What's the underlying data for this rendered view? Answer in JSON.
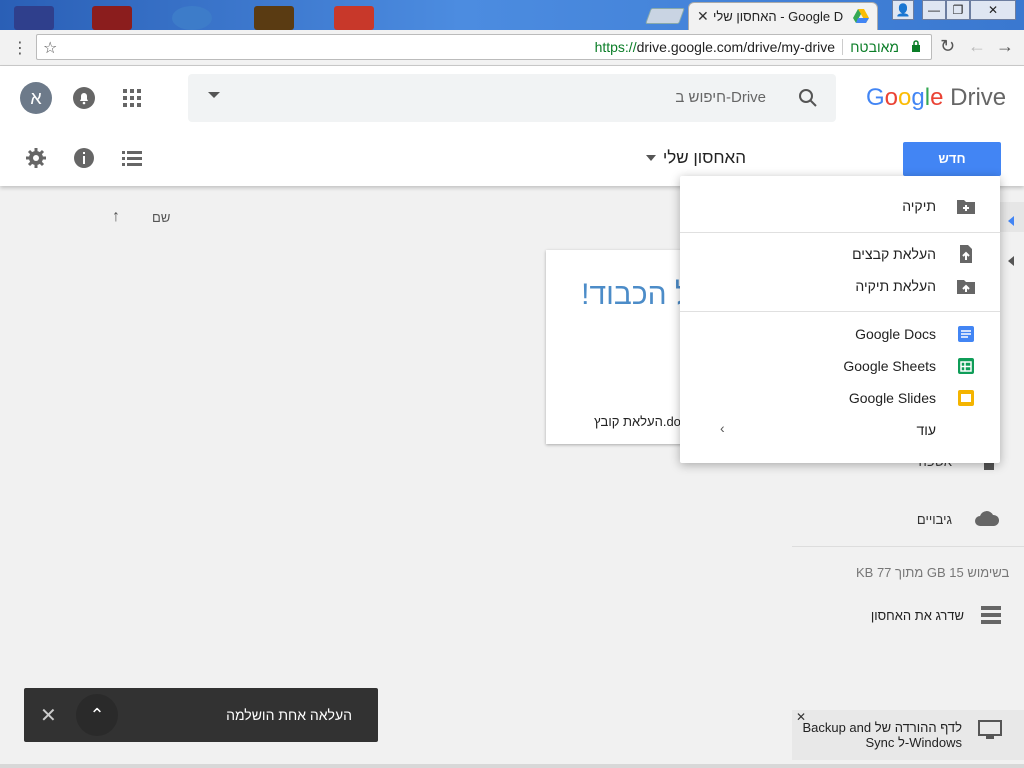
{
  "browser": {
    "tab_title": "האחסון שלי - Google Drive",
    "url_scheme": "https://",
    "url_rest": "drive.google.com/drive/my-drive",
    "secure_label": "מאובטח"
  },
  "header": {
    "avatar_letter": "א",
    "search_placeholder": "חיפוש ב-Drive",
    "logo_google": [
      "G",
      "o",
      "o",
      "g",
      "l",
      "e"
    ],
    "logo_colors": [
      "#4285f4",
      "#ea4335",
      "#fbbc05",
      "#4285f4",
      "#34a853",
      "#ea4335"
    ],
    "logo_drive": "Drive",
    "breadcrumb": "האחסון שלי",
    "new_button": "חדש"
  },
  "list": {
    "sort_label": "שם"
  },
  "file": {
    "preview_text": "כל הכבוד!",
    "name": "העלאת קובץ.docx"
  },
  "new_menu": {
    "folder": "תיקיה",
    "upload_files": "העלאת קבצים",
    "upload_folder": "העלאת תיקיה",
    "docs": "Google Docs",
    "sheets": "Google Sheets",
    "slides": "Google Slides",
    "more": "עוד"
  },
  "sidebar": {
    "trash": "אשפה",
    "backups": "גיבויים",
    "storage": "KB 77 מתוך GB 15 בשימוש",
    "upgrade": "שדרג את האחסון"
  },
  "toast": {
    "message": "העלאה אחת הושלמה"
  },
  "promo": {
    "line1": "Backup and לדף ההורדה של",
    "line2": "Sync ל-Windows"
  },
  "colors": {
    "accent": "#4285f4",
    "docs": "#4285f4",
    "sheets": "#0f9d58",
    "slides": "#f4b400"
  }
}
